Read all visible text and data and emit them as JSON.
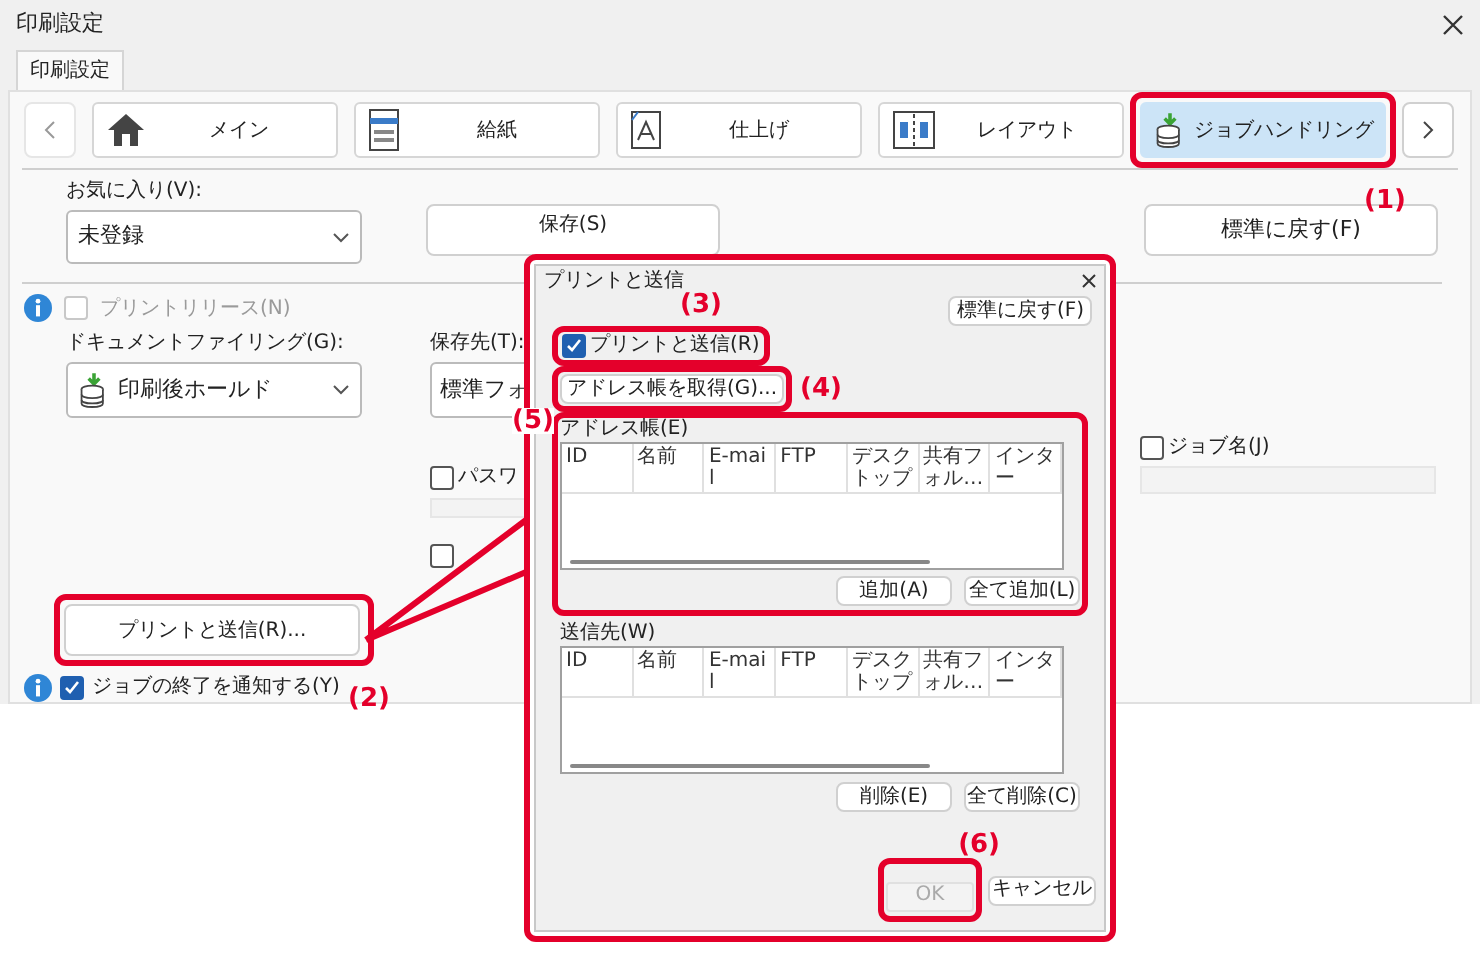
{
  "window": {
    "title": "印刷設定"
  },
  "tabs": [
    {
      "label": "印刷設定",
      "selected": true
    }
  ],
  "nav_items": [
    {
      "label": "メイン",
      "selected": false
    },
    {
      "label": "給紙",
      "selected": false
    },
    {
      "label": "仕上げ",
      "selected": false
    },
    {
      "label": "レイアウト",
      "selected": false
    },
    {
      "label": "ジョブハンドリング",
      "selected": true
    }
  ],
  "favorites": {
    "label": "お気に入り(V):",
    "value": "未登録"
  },
  "save_button": "保存(S)",
  "reset_button": "標準に戻す(F)",
  "print_release": {
    "label": "プリントリリース(N)",
    "checked": false,
    "disabled": true
  },
  "document_filing": {
    "label": "ドキュメントファイリング(G):",
    "value": "印刷後ホールド"
  },
  "storage": {
    "label": "保存先(T):",
    "value": "標準フォ"
  },
  "password": {
    "label": "パスワ",
    "checked": false
  },
  "option_checkbox": {
    "checked": false
  },
  "job_name": {
    "label": "ジョブ名(J)",
    "checked": false
  },
  "print_and_send_button": "プリントと送信(R)...",
  "notify": {
    "label": "ジョブの終了を通知する(Y)",
    "checked": true
  },
  "dialog": {
    "title": "プリントと送信",
    "reset_button": "標準に戻す(F)",
    "print_and_send": {
      "label": "プリントと送信(R)",
      "checked": true
    },
    "get_address_book": "アドレス帳を取得(G)...",
    "address_book": {
      "label": "アドレス帳(E)",
      "columns": [
        "ID",
        "名前",
        "E-mail",
        "FTP",
        "デスクトップ",
        "共有フォル…",
        "インター"
      ]
    },
    "add_buttons": [
      "追加(A)",
      "全て追加(L)"
    ],
    "destinations": {
      "label": "送信先(W)",
      "columns": [
        "ID",
        "名前",
        "E-mail",
        "FTP",
        "デスクトップ",
        "共有フォル…",
        "インター"
      ]
    },
    "remove_buttons": [
      "削除(E)",
      "全て削除(C)"
    ],
    "ok_button": {
      "label": "OK",
      "disabled": true
    },
    "cancel_button": "キャンセル"
  },
  "callouts": [
    "(1)",
    "(2)",
    "(3)",
    "(4)",
    "(5)",
    "(6)"
  ]
}
